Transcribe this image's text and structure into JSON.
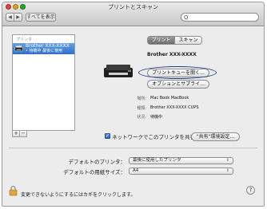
{
  "window": {
    "title": "プリントとスキャン"
  },
  "toolbar": {
    "back_glyph": "◀",
    "forward_glyph": "▶",
    "show_all_label": "すべてを表示",
    "search_glyph": "Q",
    "search_placeholder": ""
  },
  "sidebar": {
    "header": "プリンタ",
    "items": [
      {
        "name": "Brother XXX-XXXX",
        "status": "• 待機中 最後に使用",
        "icon": "printer-icon",
        "selected": true
      }
    ],
    "add_label": "+",
    "remove_label": "−"
  },
  "detail": {
    "tabs": [
      {
        "label": "プリント",
        "active": true
      },
      {
        "label": "スキャン",
        "active": false
      }
    ],
    "model_name": "Brother XXX-XXXX",
    "open_queue_label": "プリントキューを開く...",
    "options_label": "オプションとサプライ...",
    "info": [
      {
        "label": "場所:",
        "value": "Mac Book MacBook"
      },
      {
        "label": "種類:",
        "value": "Brother XXX-XXXX CUPS"
      },
      {
        "label": "状況:",
        "value": "待機中"
      }
    ],
    "share_label": "ネットワークでこのプリンタを共有",
    "share_checked": true,
    "sharing_prefs_label": "\"共有\"環境設定..."
  },
  "prefs": {
    "default_printer_label": "デフォルトのプリンタ：",
    "default_printer_value": "最後に使用したプリンタ",
    "default_paper_label": "デフォルトの用紙サイズ：",
    "default_paper_value": "A4",
    "popup_arrows": "⇕"
  },
  "footer": {
    "lock_text": "変更できないようにするにはカギをクリックします。",
    "help_label": "?"
  },
  "colors": {
    "selection": "#3a78cf",
    "highlight_ring": "#1f3b8f",
    "close": "#e0443e",
    "minimize": "#dea123",
    "zoom": "#1aab29"
  }
}
